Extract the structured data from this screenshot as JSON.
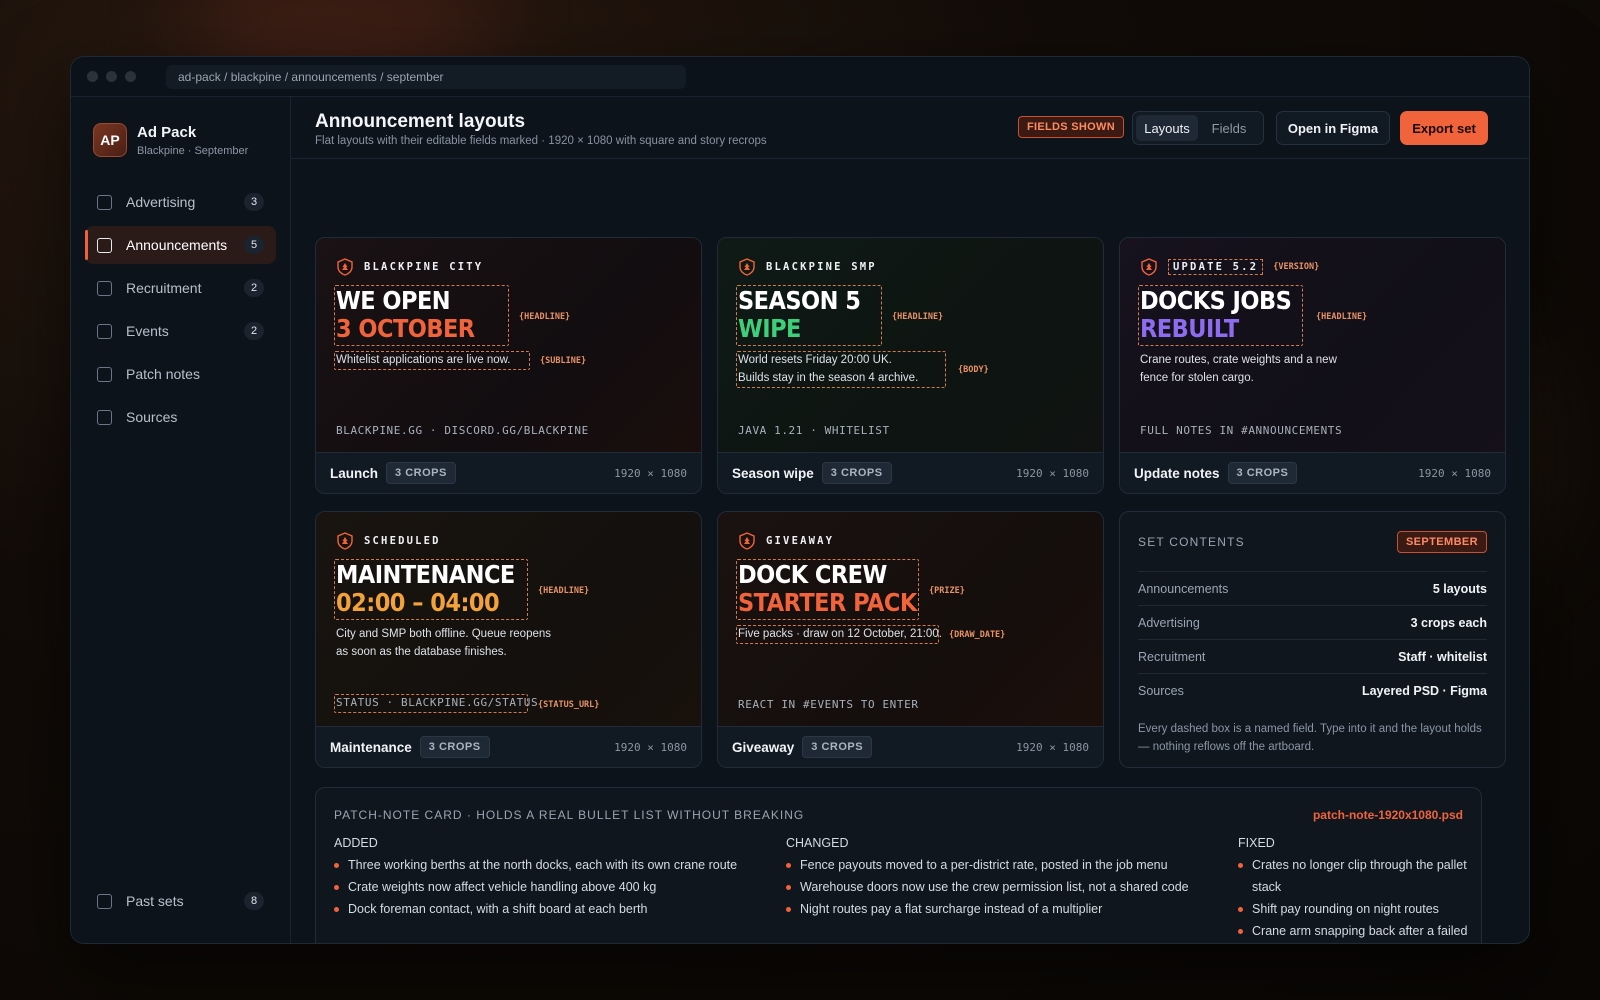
{
  "window": {
    "url": "ad-pack / blackpine / announcements / september"
  },
  "brand": {
    "initials": "AP",
    "title": "Ad Pack",
    "subtitle": "Blackpine · September"
  },
  "sidebar": {
    "items": [
      {
        "label": "Advertising",
        "count": "3",
        "active": false
      },
      {
        "label": "Announcements",
        "count": "5",
        "active": true
      },
      {
        "label": "Recruitment",
        "count": "2",
        "active": false
      },
      {
        "label": "Events",
        "count": "2",
        "active": false
      },
      {
        "label": "Patch notes",
        "count": "",
        "active": false
      },
      {
        "label": "Sources",
        "count": "",
        "active": false
      }
    ],
    "bottom": {
      "label": "Past sets",
      "count": "8"
    }
  },
  "header": {
    "title": "Announcement layouts",
    "subtitle": "Flat layouts with their editable fields marked · 1920 × 1080 with square and story recrops",
    "fields_badge": "FIELDS SHOWN",
    "toggle": {
      "layouts": "Layouts",
      "fields": "Fields",
      "selected": "Layouts"
    },
    "figma_button": "Open in Figma",
    "export_button": "Export set"
  },
  "cards": [
    {
      "kicker": "BLACKPINE CITY",
      "headline_1": "WE OPEN",
      "headline_2": "3 OCTOBER",
      "headline_tag": "{HEADLINE}",
      "body": "Whitelist applications are live now.",
      "body_2": "",
      "body_tag": "{SUBLINE}",
      "footer": "BLACKPINE.GG · DISCORD.GG/BLACKPINE",
      "name": "Launch",
      "crops": "3 CROPS",
      "size": "1920 × 1080",
      "accent": "#f1633b"
    },
    {
      "kicker": "BLACKPINE SMP",
      "headline_1": "SEASON 5",
      "headline_2": "WIPE",
      "headline_tag": "{HEADLINE}",
      "body": "World resets Friday 20:00 UK.",
      "body_2": "Builds stay in the season 4 archive.",
      "body_tag": "{BODY}",
      "footer": "JAVA 1.21 · WHITELIST",
      "name": "Season wipe",
      "crops": "3 CROPS",
      "size": "1920 × 1080",
      "accent": "#3ecf7a"
    },
    {
      "kicker": "UPDATE 5.2",
      "kicker_tag": "{VERSION}",
      "headline_1": "DOCKS JOBS",
      "headline_2": "REBUILT",
      "headline_tag": "{HEADLINE}",
      "body": "Crane routes, crate weights and a new",
      "body_2": "fence for stolen cargo.",
      "footer": "FULL NOTES IN #ANNOUNCEMENTS",
      "name": "Update notes",
      "crops": "3 CROPS",
      "size": "1920 × 1080",
      "accent": "#8e6cf2"
    },
    {
      "kicker": "SCHEDULED",
      "headline_1": "MAINTENANCE",
      "headline_2": "02:00 – 04:00",
      "headline_tag": "{HEADLINE}",
      "body": "City and SMP both offline. Queue reopens",
      "body_2": "as soon as the database finishes.",
      "footer": "STATUS · BLACKPINE.GG/STATUS",
      "footer_tag": "{STATUS_URL}",
      "name": "Maintenance",
      "crops": "3 CROPS",
      "size": "1920 × 1080",
      "accent": "#f3a13a"
    },
    {
      "kicker": "GIVEAWAY",
      "headline_1": "DOCK CREW",
      "headline_2": "STARTER PACK",
      "headline_tag": "{PRIZE}",
      "body": "Five packs · draw on 12 October, 21:00.",
      "body_tag": "{DRAW_DATE}",
      "footer": "REACT IN #EVENTS TO ENTER",
      "name": "Giveaway",
      "crops": "3 CROPS",
      "size": "1920 × 1080",
      "accent": "#f1633b"
    }
  ],
  "set_contents": {
    "title": "SET CONTENTS",
    "badge": "SEPTEMBER",
    "rows": [
      {
        "k": "Announcements",
        "v": "5 layouts"
      },
      {
        "k": "Advertising",
        "v": "3 crops each"
      },
      {
        "k": "Recruitment",
        "v": "Staff · whitelist"
      },
      {
        "k": "Sources",
        "v": "Layered PSD · Figma"
      }
    ],
    "note": "Every dashed box is a named field. Type into it and the layout holds — nothing reflows off the artboard."
  },
  "patch": {
    "title": "PATCH-NOTE CARD · HOLDS A REAL BULLET LIST WITHOUT BREAKING",
    "file": "patch-note-1920x1080.psd",
    "columns": [
      {
        "head": "ADDED",
        "items": [
          "Three working berths at the north docks, each with its own crane route",
          "Crate weights now affect vehicle handling above 400 kg",
          "Dock foreman contact, with a shift board at each berth"
        ]
      },
      {
        "head": "CHANGED",
        "items": [
          "Fence payouts moved to a per-district rate, posted in the job menu",
          "Warehouse doors now use the crew permission list, not a shared code",
          "Night routes pay a flat surcharge instead of a multiplier"
        ]
      },
      {
        "head": "FIXED",
        "items": [
          "Crates no longer clip through the pallet stack",
          "Shift pay rounding on night routes",
          "Crane arm snapping back after a failed lift"
        ]
      }
    ]
  },
  "colors": {
    "accent": "#f1633b",
    "green": "#3ecf7a",
    "purple": "#8e6cf2",
    "amber": "#f3a13a"
  }
}
